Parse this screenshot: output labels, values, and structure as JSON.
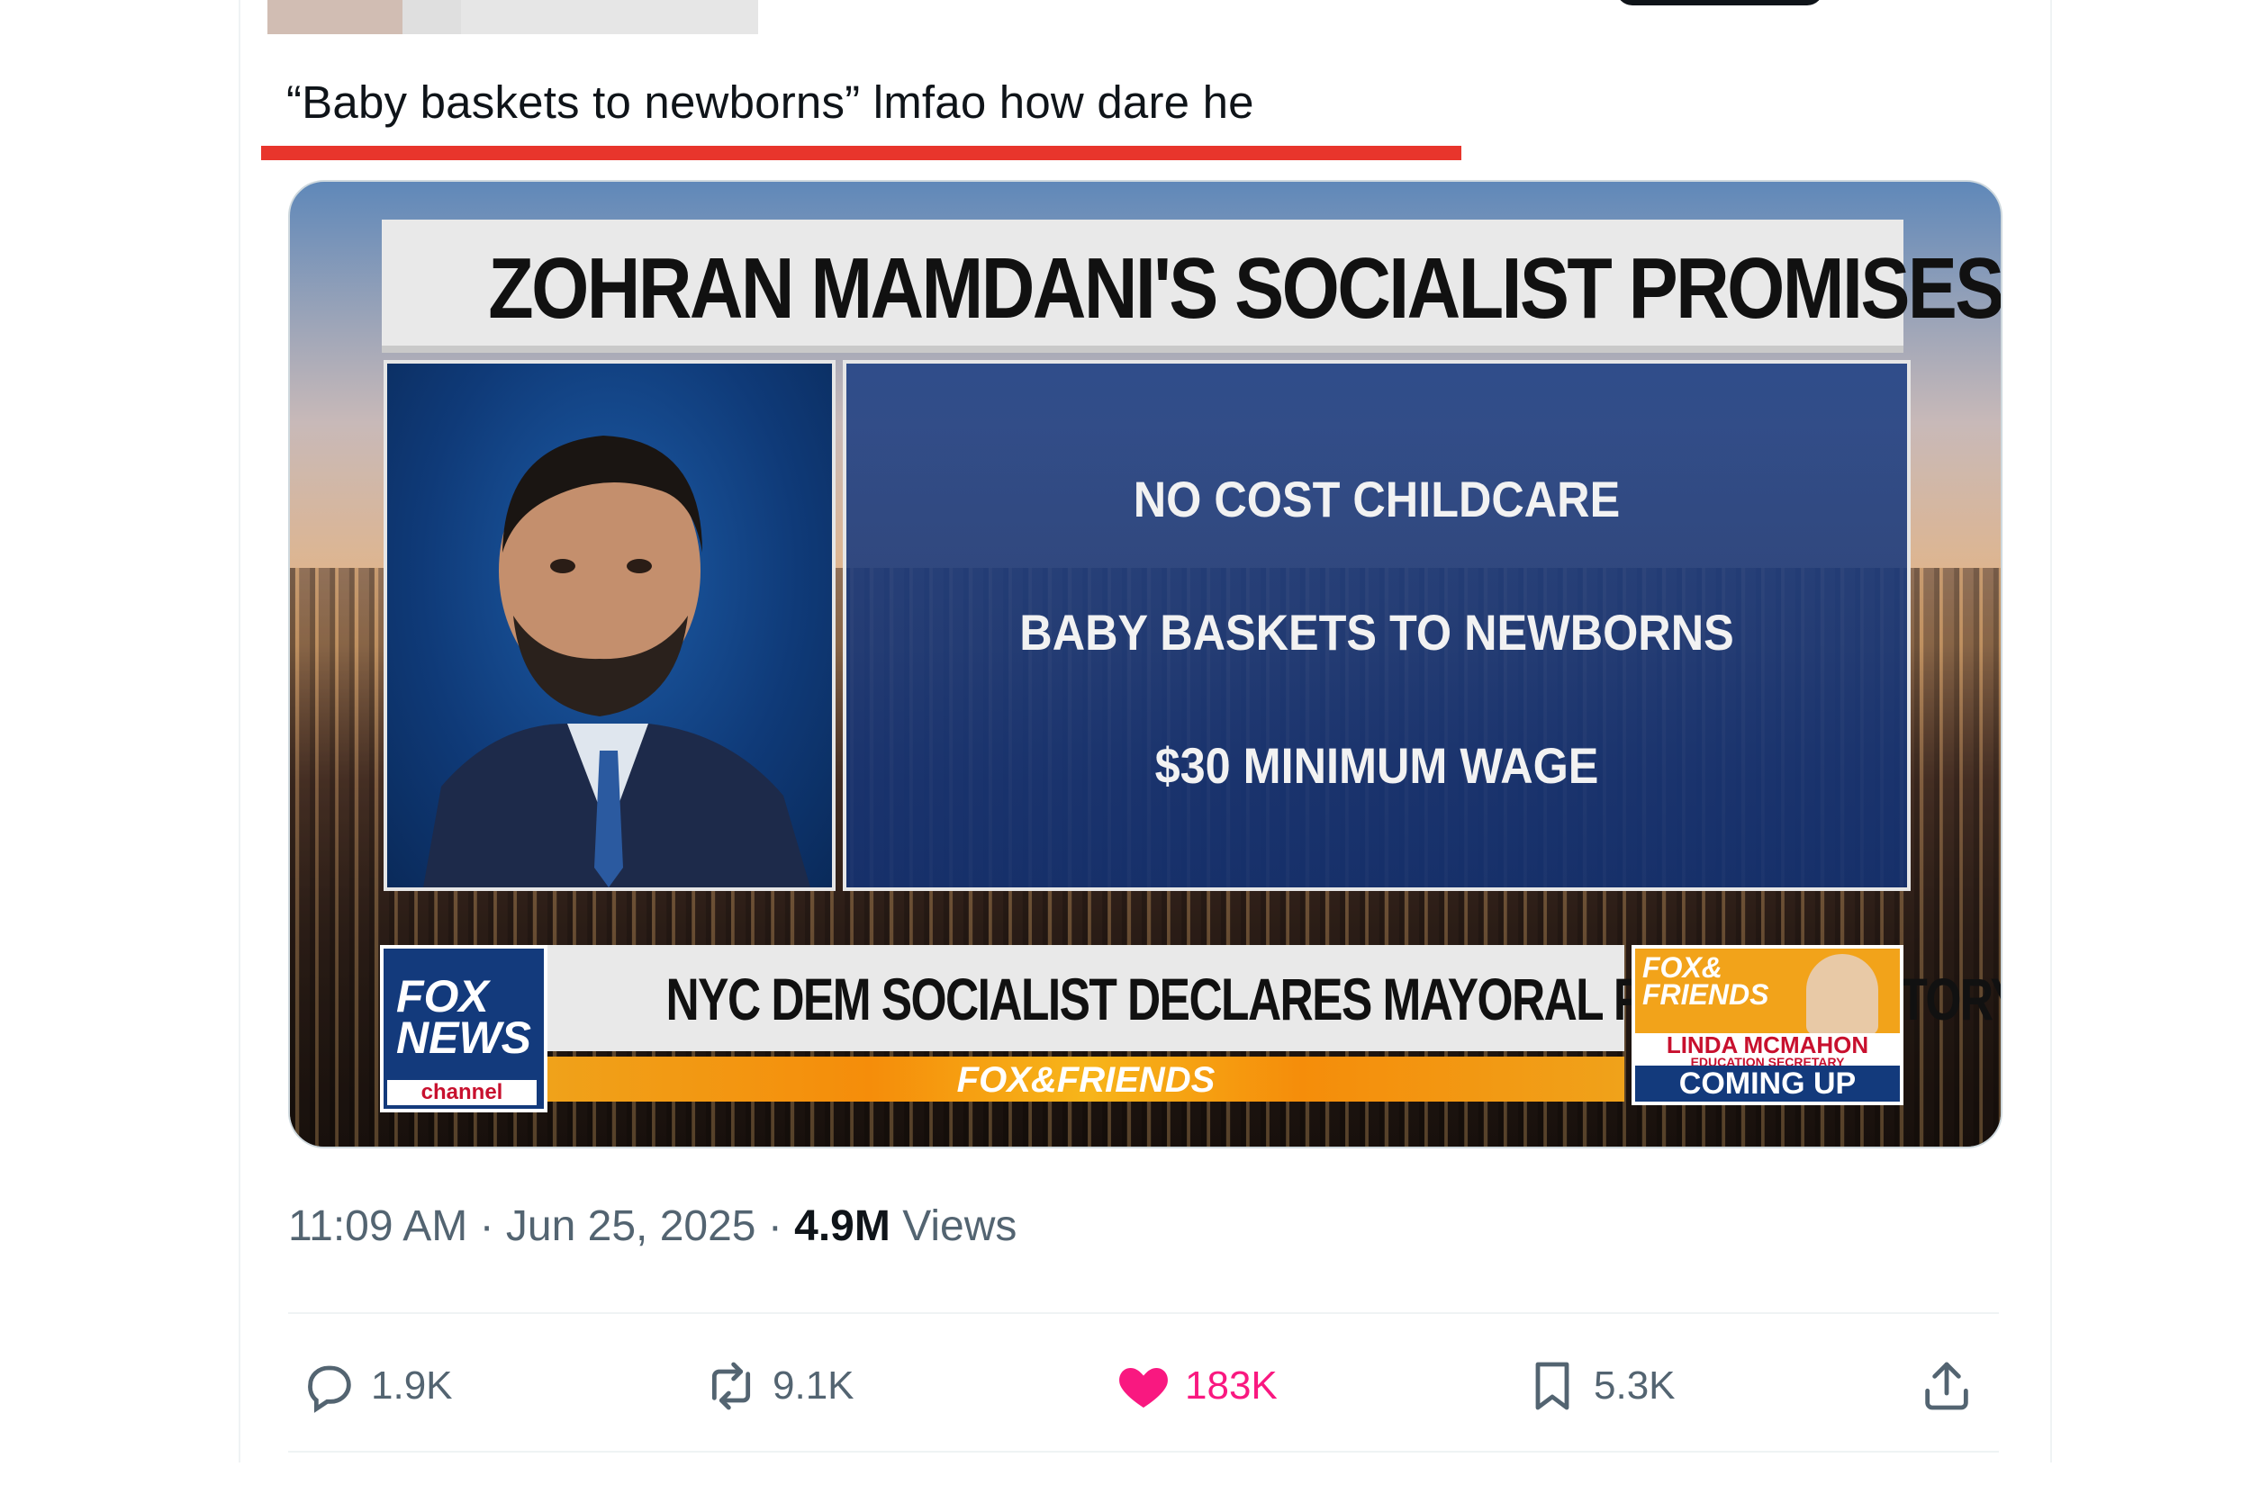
{
  "tweet": {
    "text": "“Baby baskets to newborns” lmfao how dare he"
  },
  "media": {
    "headline": "ZOHRAN MAMDANI'S SOCIALIST PROMISES",
    "promises": [
      "NO COST CHILDCARE",
      "BABY BASKETS TO NEWBORNS",
      "$30 MINIMUM WAGE"
    ],
    "logo": {
      "line1": "FOX",
      "line2": "NEWS",
      "channel": "channel"
    },
    "ticker": "NYC DEM SOCIALIST DECLARES MAYORAL PRIMARY VICTORY",
    "show_strip": "FOX&FRIENDS",
    "promo": {
      "brand_line1": "FOX&",
      "brand_line2": "FRIENDS",
      "name": "LINDA MCMAHON",
      "title": "EDUCATION SECRETARY",
      "cta": "COMING UP"
    }
  },
  "meta": {
    "time": "11:09 AM",
    "date": "Jun 25, 2025",
    "views_count": "4.9M",
    "views_label": "Views",
    "sep": " · "
  },
  "actions": {
    "replies": "1.9K",
    "reposts": "9.1K",
    "likes": "183K",
    "bookmarks": "5.3K"
  },
  "colors": {
    "like_pink": "#f91880",
    "muted": "#536471",
    "text": "#0f1419",
    "annotation_red": "#e8352c"
  }
}
